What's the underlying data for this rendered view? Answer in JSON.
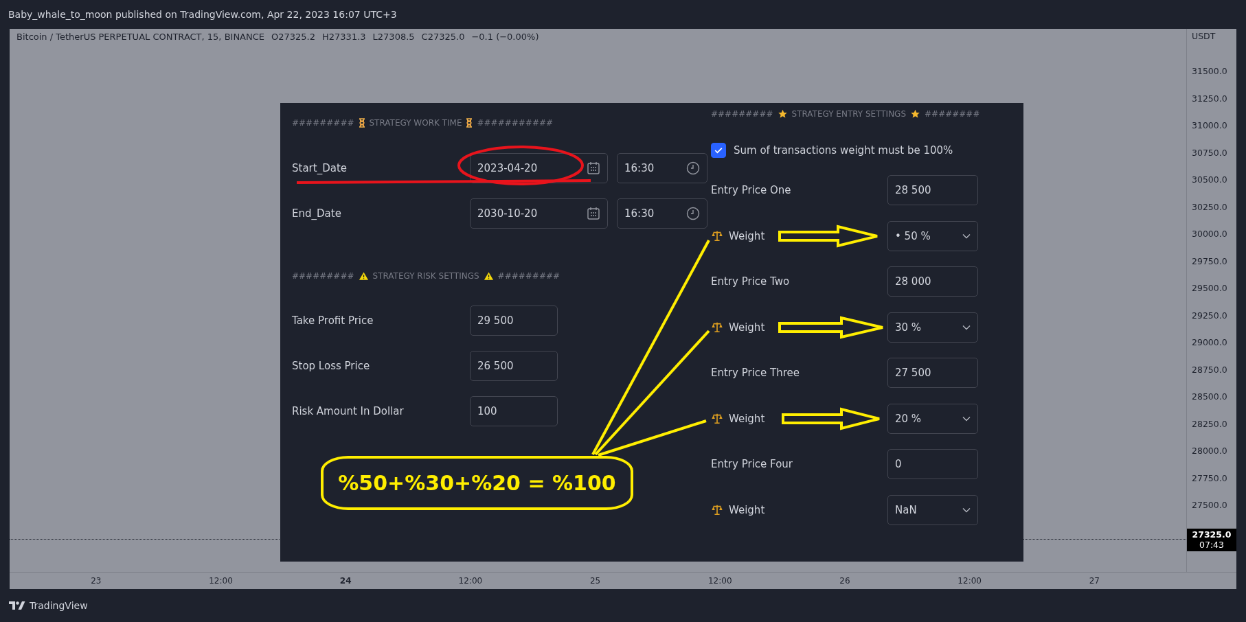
{
  "header": {
    "title": "Baby_whale_to_moon published on TradingView.com, Apr 22, 2023 16:07 UTC+3"
  },
  "legend": {
    "symbol": "Bitcoin / TetherUS PERPETUAL CONTRACT, 15, BINANCE",
    "open": "O27325.2",
    "high": "H27331.3",
    "low": "L27308.5",
    "close": "C27325.0",
    "change": "−0.1 (−0.00%)"
  },
  "price_axis": {
    "currency": "USDT",
    "labels": [
      "31500.0",
      "31250.0",
      "31000.0",
      "30750.0",
      "30500.0",
      "30250.0",
      "30000.0",
      "29750.0",
      "29500.0",
      "29250.0",
      "29000.0",
      "28750.0",
      "28500.0",
      "28250.0",
      "28000.0",
      "27750.0",
      "27500.0"
    ],
    "last_price": "27325.0",
    "countdown": "07:43"
  },
  "time_axis": {
    "labels": [
      {
        "text": "23",
        "bold": false
      },
      {
        "text": "12:00",
        "bold": false
      },
      {
        "text": "24",
        "bold": true
      },
      {
        "text": "12:00",
        "bold": false
      },
      {
        "text": "25",
        "bold": false
      },
      {
        "text": "12:00",
        "bold": false
      },
      {
        "text": "26",
        "bold": false
      },
      {
        "text": "12:00",
        "bold": false
      },
      {
        "text": "27",
        "bold": false
      }
    ]
  },
  "dialog": {
    "work_time": {
      "hashes_left": "#########",
      "heading": "STRATEGY WORK TIME",
      "hashes_right": "###########",
      "rows": [
        {
          "label": "Start_Date",
          "date": "2023-04-20",
          "time": "16:30"
        },
        {
          "label": "End_Date",
          "date": "2030-10-20",
          "time": "16:30"
        }
      ]
    },
    "risk": {
      "hashes_left": "#########",
      "heading": "STRATEGY RISK SETTINGS",
      "hashes_right": "#########",
      "rows": [
        {
          "label": "Take Profit Price",
          "value": "29 500"
        },
        {
          "label": "Stop Loss Price",
          "value": "26 500"
        },
        {
          "label": "Risk Amount In Dollar",
          "value": "100"
        }
      ]
    },
    "entry": {
      "hashes_left": "#########",
      "heading": "STRATEGY ENTRY SETTINGS",
      "hashes_right": "########",
      "checkbox": {
        "label": "Sum of transactions weight must be 100%",
        "checked": true
      },
      "rows": [
        {
          "kind": "input",
          "label": "Entry Price One",
          "value": "28 500"
        },
        {
          "kind": "select",
          "label": "Weight",
          "value": "• 50 %"
        },
        {
          "kind": "input",
          "label": "Entry Price Two",
          "value": "28 000"
        },
        {
          "kind": "select",
          "label": "Weight",
          "value": "30 %"
        },
        {
          "kind": "input",
          "label": "Entry Price Three",
          "value": "27 500"
        },
        {
          "kind": "select",
          "label": "Weight",
          "value": "20 %"
        },
        {
          "kind": "input",
          "label": "Entry Price Four",
          "value": "0"
        },
        {
          "kind": "select",
          "label": "Weight",
          "value": "NaN"
        }
      ]
    }
  },
  "annotation": {
    "formula": "%50+%30+%20 = %100"
  },
  "footer": {
    "brand": "TradingView"
  }
}
